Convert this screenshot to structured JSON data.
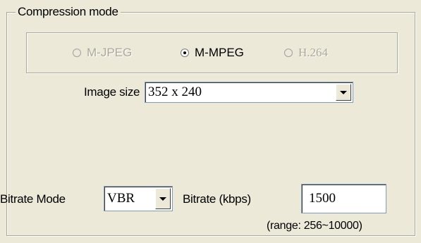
{
  "compression": {
    "group_title": "Compression mode",
    "options": [
      {
        "label": "M-JPEG",
        "enabled": false,
        "selected": false
      },
      {
        "label": "M-MPEG",
        "enabled": true,
        "selected": true
      },
      {
        "label": "H.264",
        "enabled": false,
        "selected": false
      }
    ]
  },
  "image_size": {
    "label": "Image size",
    "value": "352 x 240"
  },
  "bitrate_mode": {
    "label": "Bitrate Mode",
    "value": "VBR"
  },
  "bitrate": {
    "label": "Bitrate (kbps)",
    "value": "1500",
    "range_note": "(range: 256~10000)"
  },
  "colors": {
    "background": "#ece9d8",
    "disabled_text": "#aca899",
    "input_border": "#7f9db9"
  },
  "icons": {
    "dropdown": "chevron-down-icon",
    "radio": "radio-button-icon"
  }
}
